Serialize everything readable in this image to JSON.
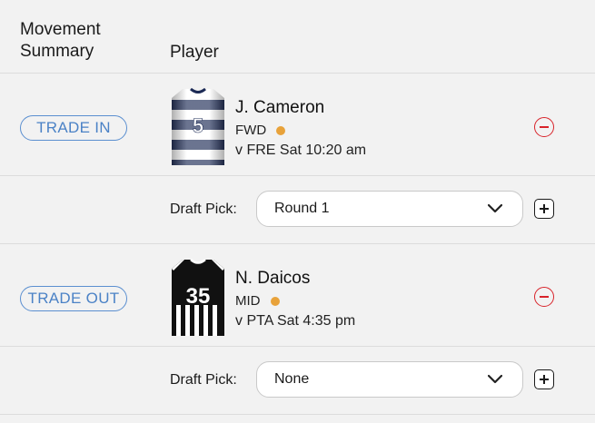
{
  "header": {
    "movement_summary": "Movement Summary",
    "player": "Player"
  },
  "movements": [
    {
      "type_label": "TRADE IN",
      "player": {
        "name": "J. Cameron",
        "position": "FWD",
        "status_color": "#e8a23a",
        "fixture": "v  FRE Sat 10:20 am",
        "jersey_number": "5",
        "jersey_icon": "geelong-jersey-icon"
      },
      "draft_pick_label": "Draft Pick:",
      "draft_pick_value": "Round 1"
    },
    {
      "type_label": "TRADE OUT",
      "player": {
        "name": "N. Daicos",
        "position": "MID",
        "status_color": "#e8a23a",
        "fixture": "v  PTA Sat 4:35 pm",
        "jersey_number": "35",
        "jersey_icon": "collingwood-jersey-icon"
      },
      "draft_pick_label": "Draft Pick:",
      "draft_pick_value": "None"
    }
  ],
  "colors": {
    "accent_blue": "#4b82c6",
    "remove_red": "#d8232a",
    "status_orange": "#e8a23a"
  }
}
